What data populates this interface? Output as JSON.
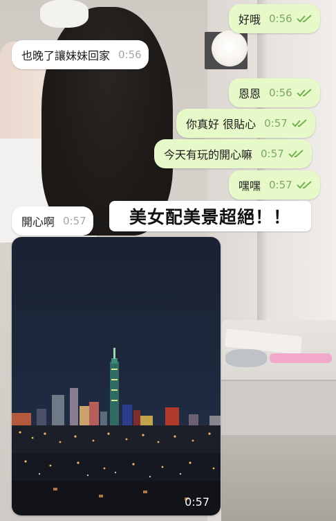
{
  "messages": [
    {
      "dir": "out",
      "text": "好哦",
      "time": "0:56",
      "read": true
    },
    {
      "dir": "in",
      "text": "也晚了讓妹妹回家",
      "time": "0:56"
    },
    {
      "dir": "out",
      "text": "恩恩",
      "time": "0:56",
      "read": true
    },
    {
      "dir": "out",
      "text": "你真好 很貼心",
      "time": "0:57",
      "read": true
    },
    {
      "dir": "out",
      "text": "今天有玩的開心嘛",
      "time": "0:57",
      "read": true
    },
    {
      "dir": "out",
      "text": "嘿嘿",
      "time": "0:57",
      "read": true
    },
    {
      "dir": "in",
      "text": "開心啊",
      "time": "0:57"
    }
  ],
  "caption": "美女配美景超絕！！",
  "media": {
    "time": "0:57"
  },
  "colors": {
    "outgoing_bubble": "#e8f9c9",
    "incoming_bubble": "#ffffff",
    "outgoing_time": "#7aa866",
    "read_ticks": "#6fb24a",
    "incoming_time": "#a6a6a6"
  },
  "icons": {
    "read_receipt": "double-check-icon"
  }
}
